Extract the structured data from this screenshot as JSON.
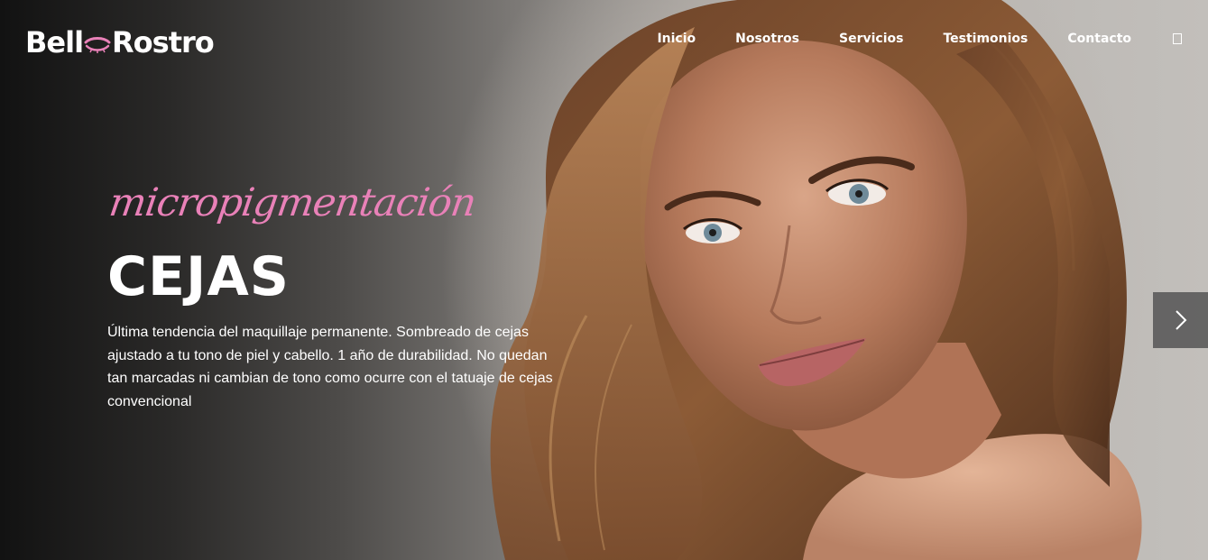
{
  "brand": {
    "logo_left": "Bell",
    "logo_right": "Rostro",
    "accent_color": "#e981b8"
  },
  "nav": {
    "items": [
      {
        "label": "Inicio"
      },
      {
        "label": "Nosotros"
      },
      {
        "label": "Servicios"
      },
      {
        "label": "Testimonios"
      },
      {
        "label": "Contacto"
      }
    ],
    "search_icon": "search-icon"
  },
  "hero": {
    "script_title": "micropigmentación",
    "title": "CEJAS",
    "description": "Última tendencia del maquillaje permanente. Sombreado de cejas ajustado a tu tono de piel y cabello. 1 año de durabilidad. No quedan tan marcadas ni cambian de tono como ocurre con el tatuaje de cejas convencional"
  },
  "slider": {
    "next_icon": "chevron-right-icon"
  }
}
